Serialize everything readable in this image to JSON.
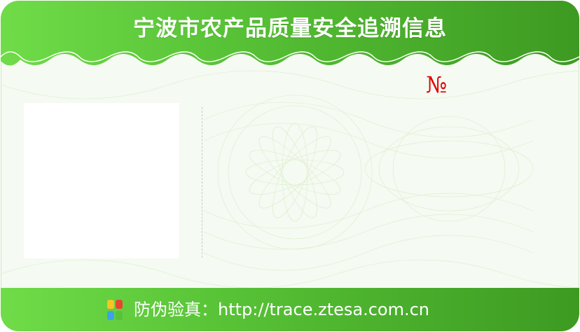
{
  "card": {
    "title": "宁波市农产品质量安全追溯信息",
    "serial_label": "№",
    "footer_label": "防伪验真：",
    "footer_url": "http://trace.ztesa.com.cn"
  },
  "colors": {
    "header_green_light": "#6fdc48",
    "header_green_dark": "#3d9a22",
    "serial_red": "#e00000",
    "background": "#f5faf2"
  },
  "icons": {
    "logo": "four-leaf-logo-icon"
  }
}
